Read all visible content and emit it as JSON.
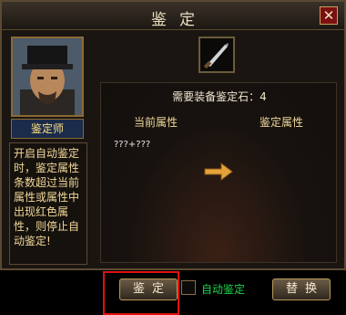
{
  "window": {
    "title": "鉴定",
    "close_glyph": "✕"
  },
  "npc": {
    "role_label": "鉴定师",
    "description": "开启自动鉴定时，鉴定属性条数超过当前属性或属性中出现红色属性，则停止自动鉴定!"
  },
  "main": {
    "required_label": "需要装备鉴定石：4",
    "current_attr_label": "当前属性",
    "identify_attr_label": "鉴定属性",
    "current_attr_value": "???+???",
    "identify_button": "鉴定",
    "auto_identify_label": "自动鉴定",
    "replace_button": "替换"
  },
  "icons": {
    "item": "dagger-icon",
    "arrow": "arrow-right-icon",
    "close": "close-icon"
  },
  "colors": {
    "auto_label": "#22d24a",
    "highlight": "#e01010",
    "role_text": "#ffe08a",
    "title_text": "#e9dcc0"
  }
}
